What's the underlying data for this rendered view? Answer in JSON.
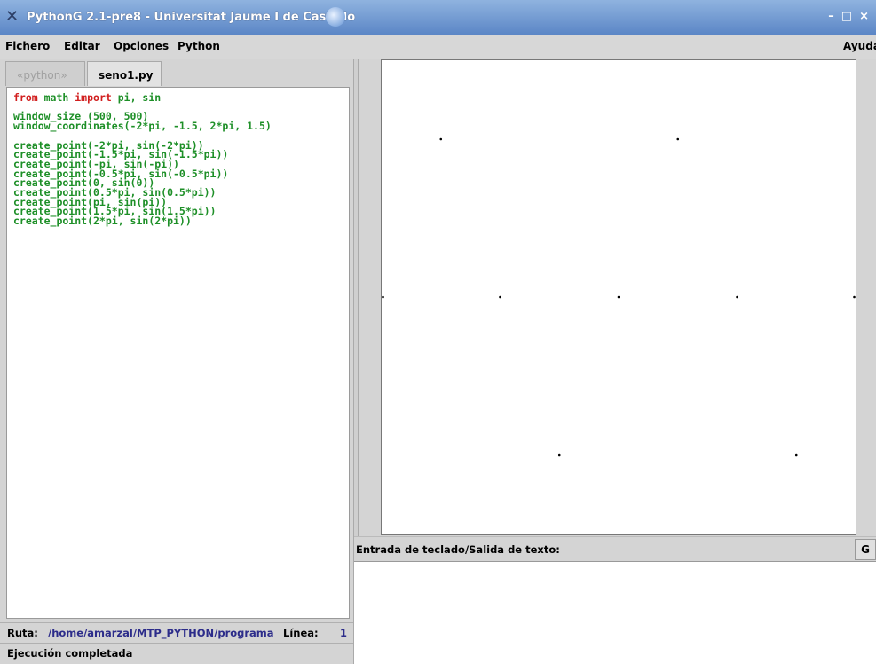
{
  "window": {
    "title": "PythonG 2.1-pre8 - Universitat Jaume I de Castello",
    "buttons": [
      "–",
      "□",
      "×"
    ]
  },
  "menu": {
    "items": [
      {
        "label": "Fichero"
      },
      {
        "label": "Editar"
      },
      {
        "label": "Opciones"
      },
      {
        "label": "Python"
      }
    ],
    "help": "Ayuda"
  },
  "tabs": [
    {
      "label": "«python»",
      "active": false
    },
    {
      "label": "seno1.py",
      "active": true
    }
  ],
  "editor": {
    "lines": [
      "from math import pi, sin",
      "",
      "window_size (500, 500)",
      "window_coordinates(-2*pi, -1.5, 2*pi, 1.5)",
      "",
      "create_point(-2*pi, sin(-2*pi))",
      "create_point(-1.5*pi, sin(-1.5*pi))",
      "create_point(-pi, sin(-pi))",
      "create_point(-0.5*pi, sin(-0.5*pi))",
      "create_point(0, sin(0))",
      "create_point(0.5*pi, sin(0.5*pi))",
      "create_point(pi, sin(pi))",
      "create_point(1.5*pi, sin(1.5*pi))",
      "create_point(2*pi, sin(2*pi))"
    ]
  },
  "status": {
    "ruta_label": "Ruta:",
    "ruta_value": "/home/amarzal/MTP_PYTHON/programa",
    "linea_label": "Línea:",
    "linea_value": "1",
    "message": "Ejecución completada"
  },
  "canvas": {
    "points": [
      {
        "x": -6.283,
        "y": 0.0
      },
      {
        "x": -4.712,
        "y": 1.0
      },
      {
        "x": -3.142,
        "y": 0.0
      },
      {
        "x": -1.571,
        "y": -1.0
      },
      {
        "x": 0.0,
        "y": 0.0
      },
      {
        "x": 1.571,
        "y": 1.0
      },
      {
        "x": 3.142,
        "y": 0.0
      },
      {
        "x": 4.712,
        "y": -1.0
      },
      {
        "x": 6.283,
        "y": 0.0
      }
    ],
    "xlim": [
      -6.283,
      6.283
    ],
    "ylim": [
      -1.5,
      1.5
    ]
  },
  "io": {
    "label": "Entrada de teclado/Salida de texto:",
    "button": "G"
  }
}
